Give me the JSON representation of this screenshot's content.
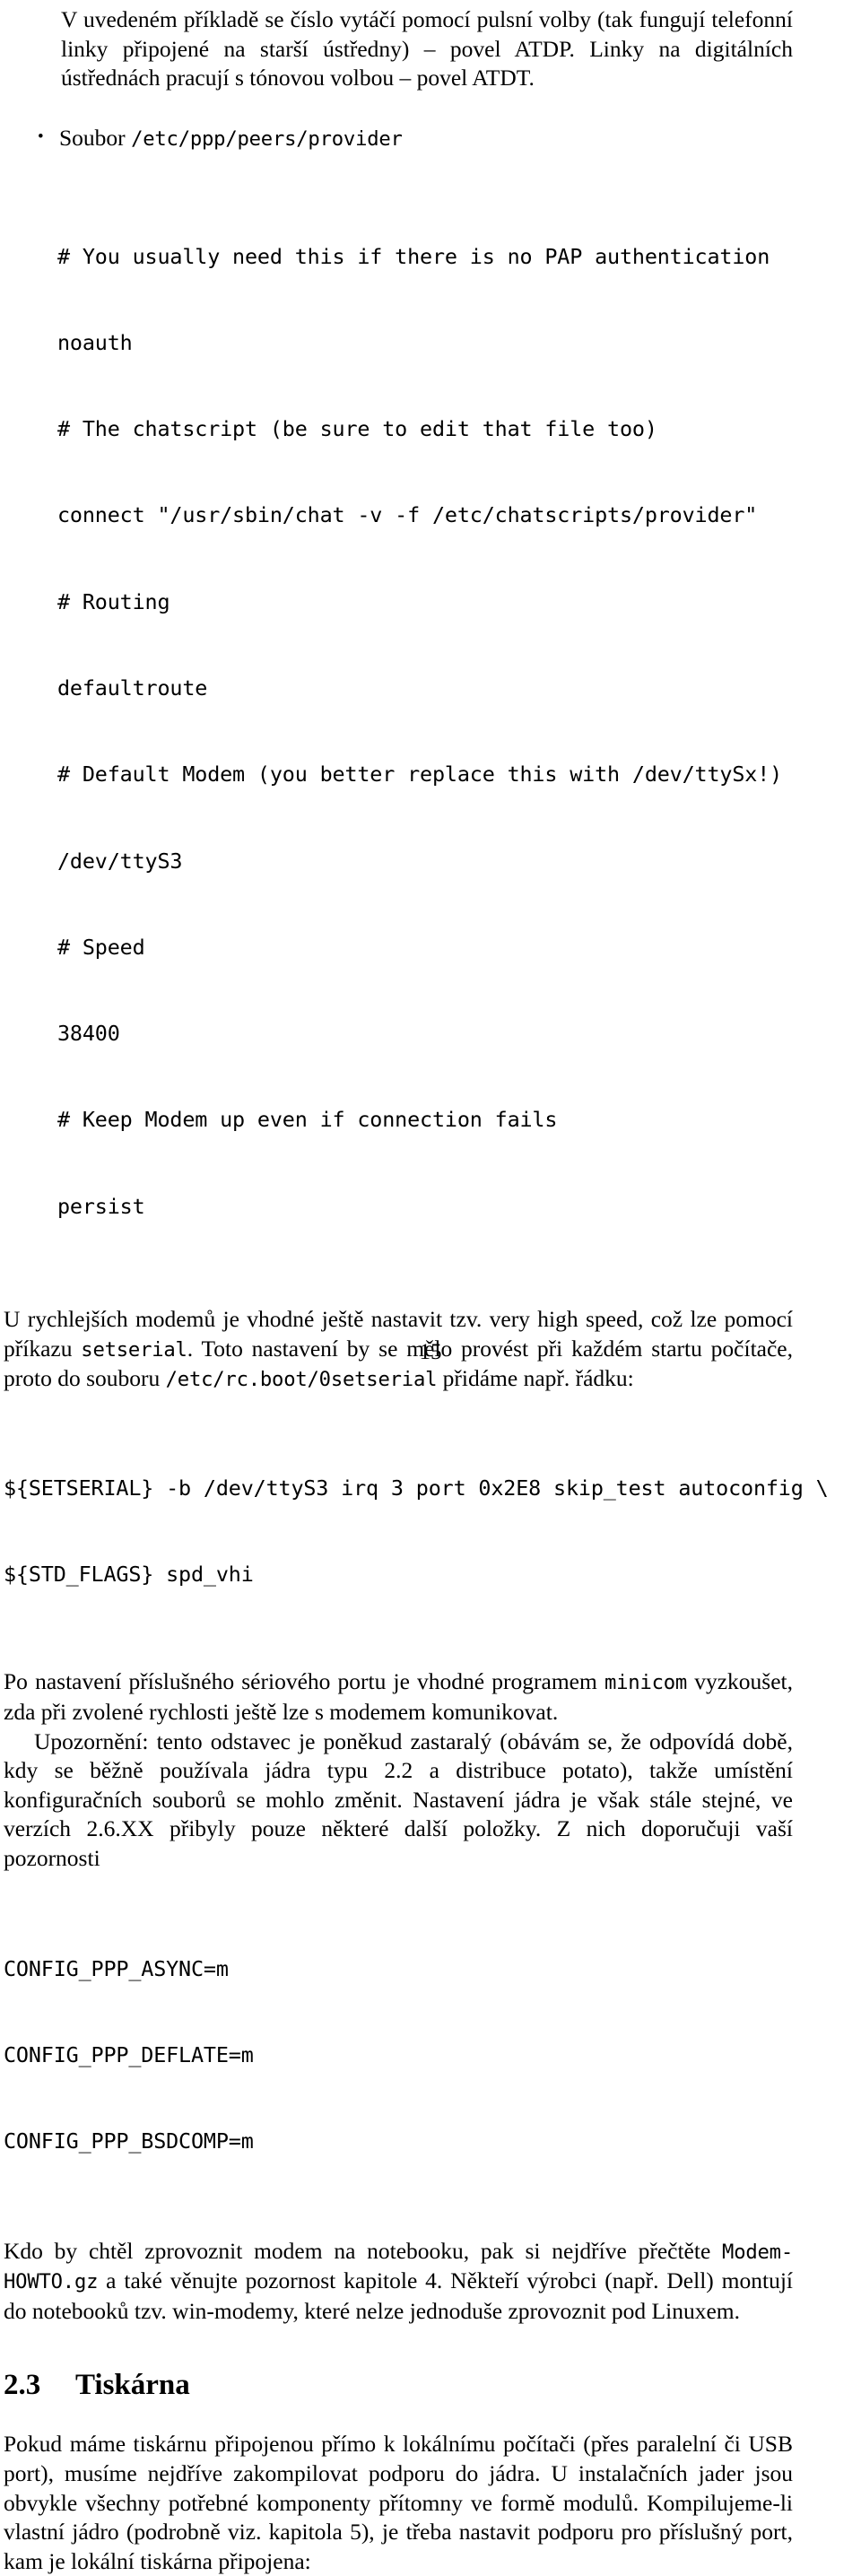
{
  "document": {
    "language": "cs",
    "page_number": "15",
    "intro_paragraph": "V uvedeném příkladě se číslo vytáčí pomocí pulsní volby (tak fungují telefonní linky připojené na starší ústředny) – povel ATDP. Linky na digitálních ústřednách pracují s tónovou volbou – povel ATDT.",
    "bullet": {
      "label": "Soubor",
      "path": "/etc/ppp/peers/provider"
    },
    "code_provider": [
      "# You usually need this if there is no PAP authentication",
      "noauth",
      "# The chatscript (be sure to edit that file too)",
      "connect \"/usr/sbin/chat -v -f /etc/chatscripts/provider\"",
      "# Routing",
      "defaultroute",
      "# Default Modem (you better replace this with /dev/ttySx!)",
      "/dev/ttyS3",
      "# Speed",
      "38400",
      "# Keep Modem up even if connection fails",
      "persist"
    ],
    "paragraph_setserial": {
      "part1": "U rychlejších modemů je vhodné ještě nastavit tzv. very high speed, což lze pomocí příkazu ",
      "code1": "setserial",
      "part2": ". Toto nastavení by se mělo provést při každém startu počítače, proto do souboru ",
      "code2": "/etc/rc.boot/0setserial",
      "part3": " přidáme např. řádku:"
    },
    "code_setserial": [
      "${SETSERIAL} -b /dev/ttyS3 irq 3 port 0x2E8 skip_test autoconfig \\",
      "${STD_FLAGS} spd_vhi"
    ],
    "paragraph_minicom": {
      "part1": "Po nastavení příslušného sériového portu je vhodné programem ",
      "code1": "minicom",
      "part2": " vyzkoušet, zda při zvolené rychlosti ještě lze s modemem komunikovat."
    },
    "paragraph_upozorneni": "Upozornění: tento odstavec je poněkud zastaralý (obávám se, že odpovídá době, kdy se běžně používala jádra typu 2.2 a distribuce potato), takže umístění konfiguračních souborů se mohlo změnit. Nastavení jádra je však stále stejné, ve verzích 2.6.XX přibyly pouze některé další položky. Z nich doporučuji vaší pozornosti",
    "code_config": [
      "CONFIG_PPP_ASYNC=m",
      "CONFIG_PPP_DEFLATE=m",
      "CONFIG_PPP_BSDCOMP=m"
    ],
    "paragraph_howto": {
      "part1": "Kdo by chtěl zprovoznit modem na notebooku, pak si nejdříve přečtěte ",
      "code1": "Modem-HOWTO.gz",
      "part2": " a také věnujte pozornost kapitole 4. Někteří výrobci (např. Dell) montují do notebooků tzv. win-modemy, které nelze jednoduše zprovoznit pod Linuxem."
    },
    "section": {
      "number": "2.3",
      "title": "Tiskárna"
    },
    "paragraph_printer": "Pokud máme tiskárnu připojenou přímo k lokálnímu počítači (přes paralelní či USB port), musíme nejdříve zakompilovat podporu do jádra. U instalačních jader jsou obvykle všechny potřebné komponenty přítomny ve formě modulů. Kompilujeme-li vlastní jádro (podrobně viz. kapitola 5), je třeba nastavit podporu pro příslušný port, kam je lokální tiskárna připojena:"
  }
}
